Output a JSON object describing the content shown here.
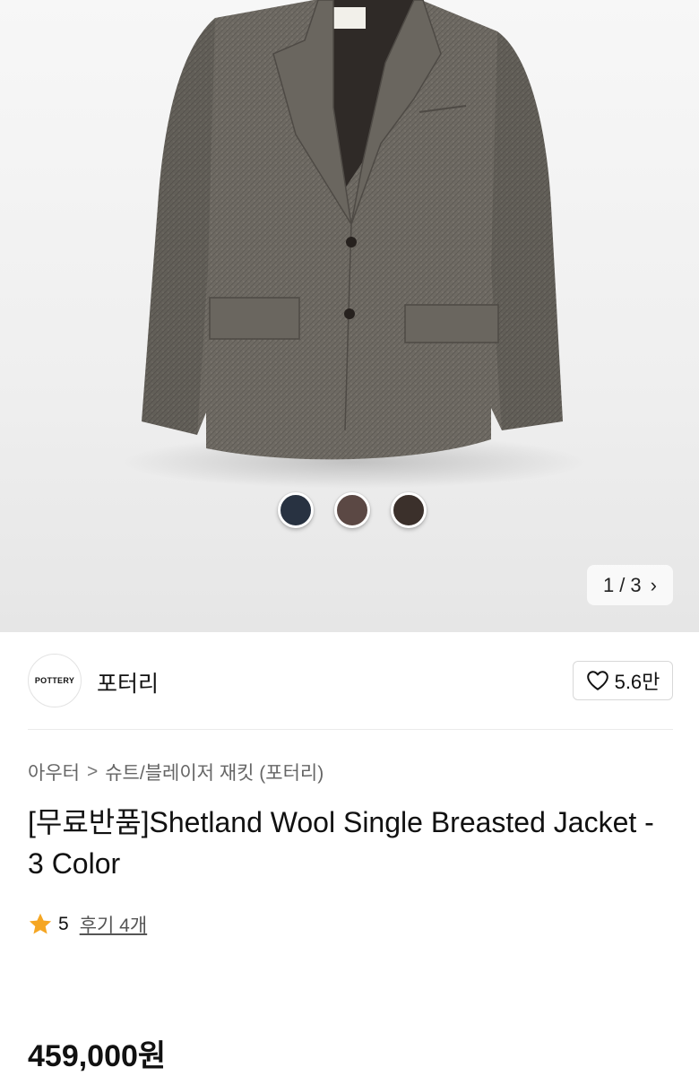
{
  "product_image": {
    "alt": "",
    "color_swatches": [
      {
        "name": "navy-swatch",
        "color": "#283241"
      },
      {
        "name": "brown-swatch",
        "color": "#5b4844"
      },
      {
        "name": "dark-brown-swatch",
        "color": "#3b302b"
      }
    ],
    "pager": {
      "current": "1",
      "separator": "/",
      "total": "3",
      "next_icon": "chevron-right-icon"
    }
  },
  "brand": {
    "logo_text": "POTTERY",
    "name": "포터리",
    "like_icon": "heart-outline-icon",
    "like_count": "5.6만"
  },
  "breadcrumb": {
    "items": [
      "아우터",
      "슈트/블레이저 재킷 (포터리)"
    ],
    "separator": ">"
  },
  "product": {
    "title": "[무료반품]Shetland Wool Single Breasted Jacket - 3 Color",
    "rating_icon": "star-icon",
    "rating": "5",
    "reviews": "후기 4개",
    "price": "459,000원"
  },
  "colors": {
    "star": "#f5a623",
    "jacket": "#6e6a63"
  }
}
